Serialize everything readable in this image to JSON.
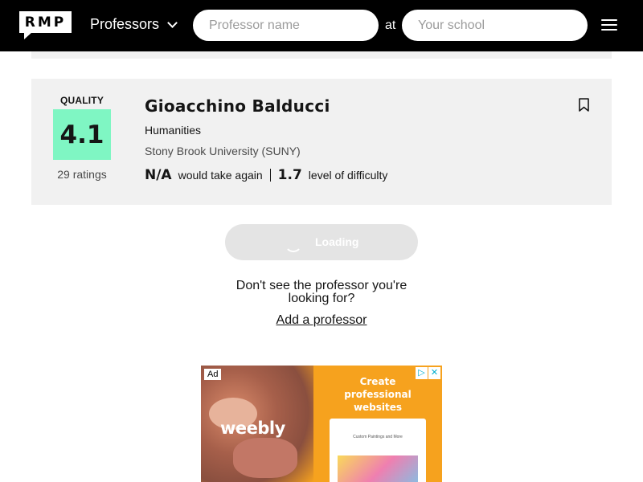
{
  "header": {
    "logo_text": "RMP",
    "nav_label": "Professors",
    "professor_search_placeholder": "Professor name",
    "at_label": "at",
    "school_search_placeholder": "Your school"
  },
  "professor": {
    "quality_label": "QUALITY",
    "quality_score": "4.1",
    "ratings_count": "29 ratings",
    "name": "Gioacchino Balducci",
    "department": "Humanities",
    "school": "Stony Brook University (SUNY)",
    "would_take_again_value": "N/A",
    "would_take_again_label": "would take again",
    "difficulty_value": "1.7",
    "difficulty_label": "level of difficulty"
  },
  "load_more": {
    "label": "Loading"
  },
  "missing": {
    "text": "Don't see the professor you're looking for?",
    "link": "Add a professor"
  },
  "ad": {
    "badge": "Ad",
    "brand": "weebly",
    "headline": "Create professional websites",
    "screen_title": "Custom Paintings and More"
  },
  "colors": {
    "header_bg": "#000000",
    "quality_green": "#7ff6c3",
    "card_bg": "#f1f1f1",
    "ad_bg": "#f6a21e"
  }
}
